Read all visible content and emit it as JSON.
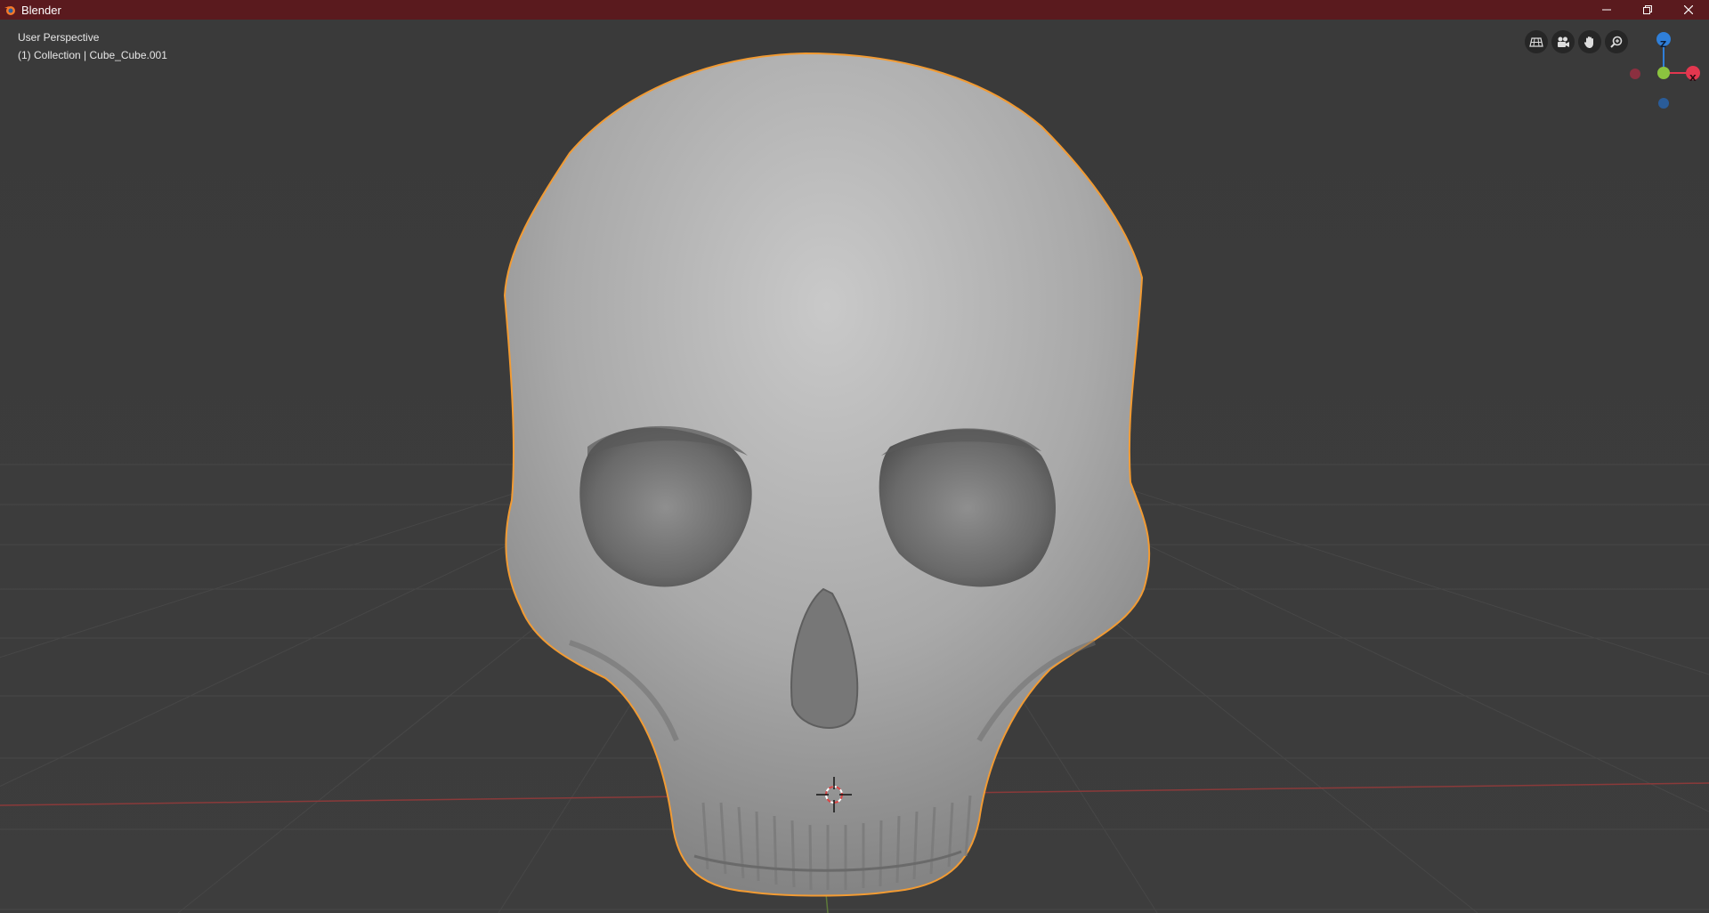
{
  "window": {
    "title": "Blender",
    "title_bar_color": "#5a1a1e"
  },
  "viewport": {
    "view_name": "User Perspective",
    "object_info": "(1) Collection | Cube_Cube.001",
    "background_color": "#3a3a3a",
    "selection_outline_color": "#f29b33"
  },
  "nav_tools": [
    {
      "icon": "grid-view-icon"
    },
    {
      "icon": "camera-icon"
    },
    {
      "icon": "hand-pan-icon"
    },
    {
      "icon": "zoom-icon"
    }
  ],
  "gizmo": {
    "z_label": "Z",
    "x_label": "X",
    "x_color": "#e3374f",
    "y_color": "#8bc43f",
    "z_color": "#2f7fd9"
  }
}
